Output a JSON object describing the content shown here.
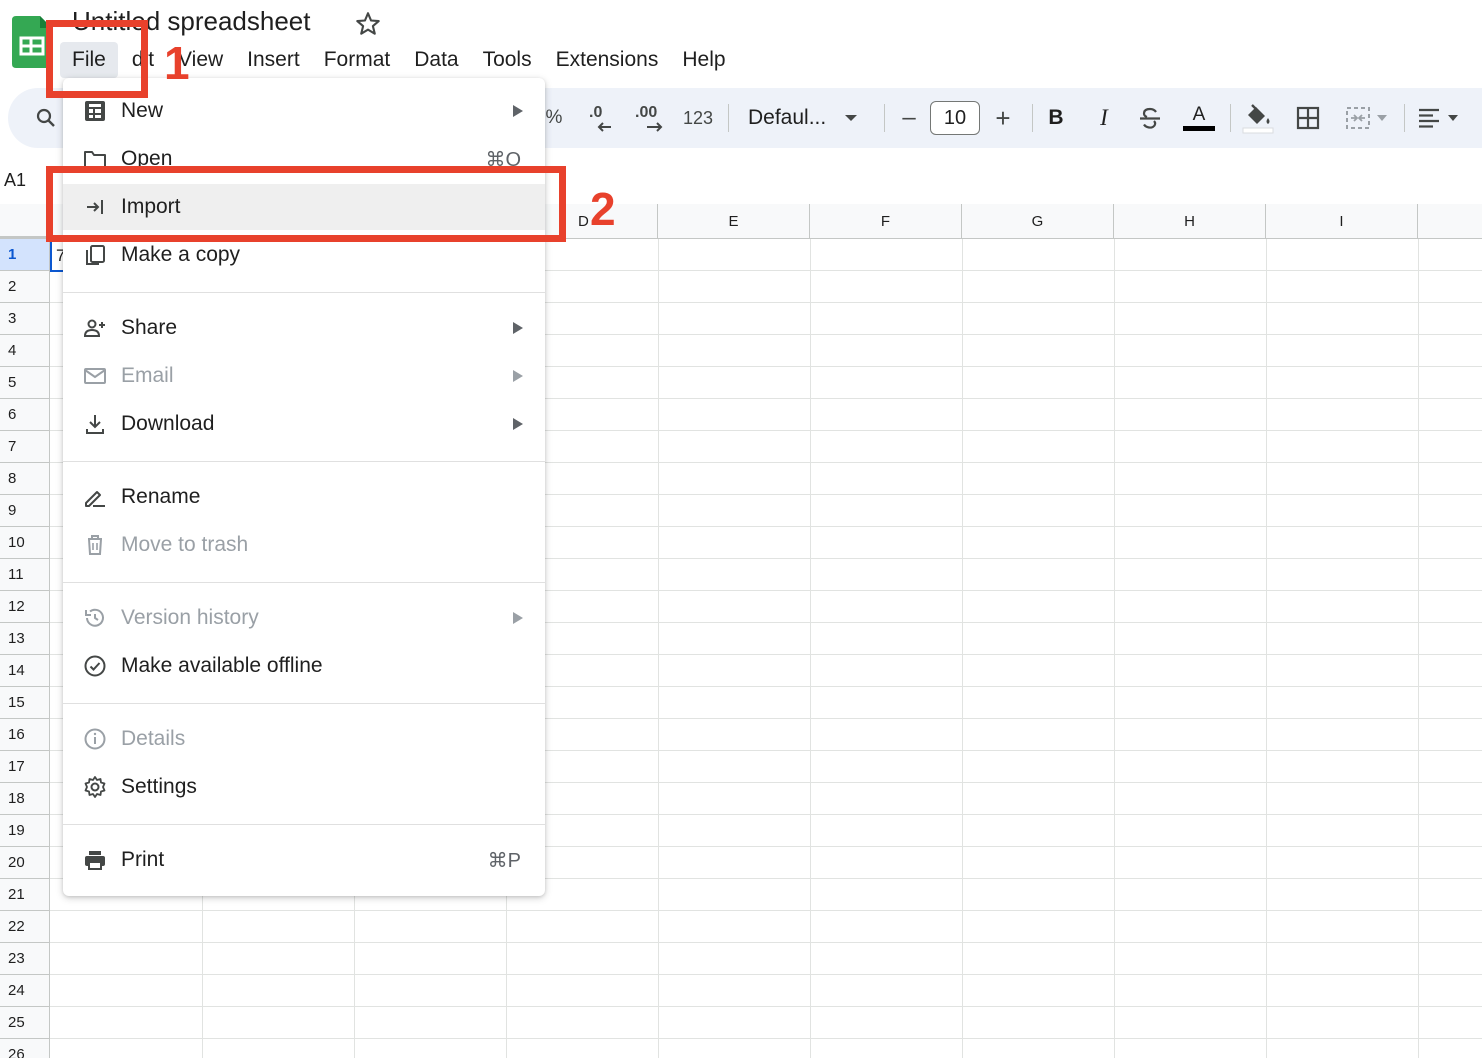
{
  "app": {
    "doc_title": "Untitled spreadsheet",
    "logo_icon": "sheets-logo-icon",
    "star_icon": "star-icon"
  },
  "menubar": {
    "items": [
      "File",
      "Edit",
      "View",
      "Insert",
      "Format",
      "Data",
      "Tools",
      "Extensions",
      "Help"
    ],
    "active": "File",
    "edit_visible_text": "dit"
  },
  "toolbar": {
    "percent": "%",
    "decrease_decimal": ".0",
    "increase_decimal": ".00",
    "number_format": "123",
    "font": "Defaul...",
    "font_size": "10",
    "minus": "–",
    "plus": "+",
    "bold": "B",
    "italic": "I",
    "text_color_letter": "A"
  },
  "name_box": "A1",
  "grid": {
    "columns": [
      "D",
      "E",
      "F",
      "G",
      "H",
      "I"
    ],
    "rows": [
      "1",
      "2",
      "3",
      "4",
      "5",
      "6",
      "7",
      "8",
      "9",
      "10",
      "11",
      "12",
      "13",
      "14",
      "15",
      "16",
      "17",
      "18",
      "19",
      "20",
      "21",
      "22",
      "23",
      "24",
      "25",
      "26"
    ],
    "selected_row": "1",
    "active_cell_fragment": "7"
  },
  "file_menu": {
    "items": [
      {
        "label": "New",
        "icon": "new-sheet-icon",
        "submenu": true,
        "shortcut": "",
        "disabled": false
      },
      {
        "label": "Open",
        "icon": "folder-icon",
        "submenu": false,
        "shortcut": "⌘O",
        "disabled": false
      },
      {
        "label": "Import",
        "icon": "import-icon",
        "submenu": false,
        "shortcut": "",
        "disabled": false,
        "hover": true
      },
      {
        "label": "Make a copy",
        "icon": "copy-icon",
        "submenu": false,
        "shortcut": "",
        "disabled": false
      },
      {
        "label": "Share",
        "icon": "share-person-icon",
        "submenu": true,
        "shortcut": "",
        "disabled": false
      },
      {
        "label": "Email",
        "icon": "email-icon",
        "submenu": true,
        "shortcut": "",
        "disabled": true
      },
      {
        "label": "Download",
        "icon": "download-icon",
        "submenu": true,
        "shortcut": "",
        "disabled": false
      },
      {
        "label": "Rename",
        "icon": "rename-pencil-icon",
        "submenu": false,
        "shortcut": "",
        "disabled": false
      },
      {
        "label": "Move to trash",
        "icon": "trash-icon",
        "submenu": false,
        "shortcut": "",
        "disabled": true
      },
      {
        "label": "Version history",
        "icon": "history-icon",
        "submenu": true,
        "shortcut": "",
        "disabled": true
      },
      {
        "label": "Make available offline",
        "icon": "offline-check-icon",
        "submenu": false,
        "shortcut": "",
        "disabled": false
      },
      {
        "label": "Details",
        "icon": "info-icon",
        "submenu": false,
        "shortcut": "",
        "disabled": true
      },
      {
        "label": "Settings",
        "icon": "gear-icon",
        "submenu": false,
        "shortcut": "",
        "disabled": false
      },
      {
        "label": "Print",
        "icon": "printer-icon",
        "submenu": false,
        "shortcut": "⌘P",
        "disabled": false
      }
    ]
  },
  "annotations": {
    "step1": "1",
    "step2": "2",
    "color": "#e8412c"
  },
  "colors": {
    "accent": "#0b57d0",
    "toolbar_bg": "#eef2f9",
    "sheets_green": "#34a853"
  }
}
